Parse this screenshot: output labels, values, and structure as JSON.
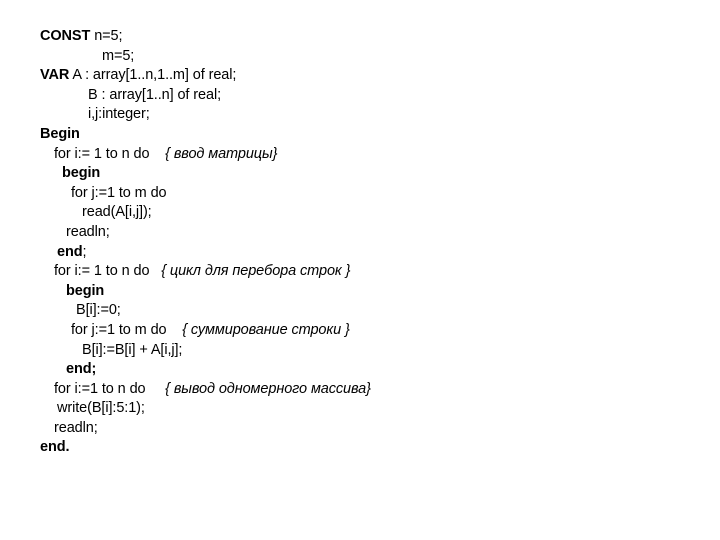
{
  "document": {
    "language": "Pascal",
    "background_color": "#ffffff",
    "text_color": "#000000",
    "lines": [
      {
        "indent": "i0",
        "segments": [
          {
            "text": "CONST",
            "style": "keyword"
          },
          {
            "text": " n=5;",
            "style": "plain"
          }
        ]
      },
      {
        "indent": "i11",
        "segments": [
          {
            "text": "m=5;",
            "style": "plain"
          }
        ]
      },
      {
        "indent": "i0",
        "segments": [
          {
            "text": "VAR",
            "style": "keyword"
          },
          {
            "text": " A : array[1..n,1..m] of real;",
            "style": "plain"
          }
        ]
      },
      {
        "indent": "i9",
        "segments": [
          {
            "text": "B : array[1..n] of real;",
            "style": "plain"
          }
        ]
      },
      {
        "indent": "i9",
        "segments": [
          {
            "text": "i,j:integer;",
            "style": "plain"
          }
        ]
      },
      {
        "indent": "i0",
        "segments": [
          {
            "text": "Begin",
            "style": "keyword"
          }
        ]
      },
      {
        "indent": "i2",
        "segments": [
          {
            "text": "for i:= 1 to n do",
            "style": "plain"
          },
          {
            "text": "    ",
            "style": "plain"
          },
          {
            "text": "{ ввод матрицы}",
            "style": "comment"
          }
        ]
      },
      {
        "indent": "i4",
        "segments": [
          {
            "text": "begin",
            "style": "keyword"
          }
        ]
      },
      {
        "indent": "i6",
        "segments": [
          {
            "text": "for j:=1 to m do",
            "style": "plain"
          }
        ]
      },
      {
        "indent": "i8",
        "segments": [
          {
            "text": "read(A[i,j]);",
            "style": "plain"
          }
        ]
      },
      {
        "indent": "i5",
        "segments": [
          {
            "text": "readln;",
            "style": "plain"
          }
        ]
      },
      {
        "indent": "i3",
        "segments": [
          {
            "text": "end",
            "style": "keyword"
          },
          {
            "text": ";",
            "style": "plain"
          }
        ]
      },
      {
        "indent": "i2",
        "segments": [
          {
            "text": "for i:= 1 to n do",
            "style": "plain"
          },
          {
            "text": "   ",
            "style": "plain"
          },
          {
            "text": "{ цикл для перебора строк }",
            "style": "comment"
          }
        ]
      },
      {
        "indent": "i5",
        "segments": [
          {
            "text": "begin",
            "style": "keyword"
          }
        ]
      },
      {
        "indent": "i7",
        "segments": [
          {
            "text": "B[i]:=0;",
            "style": "plain"
          }
        ]
      },
      {
        "indent": "i6",
        "segments": [
          {
            "text": "for j:=1 to m do",
            "style": "plain"
          },
          {
            "text": "    ",
            "style": "plain"
          },
          {
            "text": "{ суммирование строки }",
            "style": "comment"
          }
        ]
      },
      {
        "indent": "i8",
        "segments": [
          {
            "text": "B[i]:=B[i] + A[i,j];",
            "style": "plain"
          }
        ]
      },
      {
        "indent": "i5",
        "segments": [
          {
            "text": "end;",
            "style": "keyword"
          }
        ]
      },
      {
        "indent": "i2",
        "segments": [
          {
            "text": "for i:=1 to n do",
            "style": "plain"
          },
          {
            "text": "     ",
            "style": "plain"
          },
          {
            "text": "{ вывод одномерного массива}",
            "style": "comment"
          }
        ]
      },
      {
        "indent": "i3",
        "segments": [
          {
            "text": "write(B[i]:5:1);",
            "style": "plain"
          }
        ]
      },
      {
        "indent": "i2",
        "segments": [
          {
            "text": "readln;",
            "style": "plain"
          }
        ]
      },
      {
        "indent": "i0",
        "segments": [
          {
            "text": "end.",
            "style": "keyword"
          }
        ]
      }
    ]
  }
}
